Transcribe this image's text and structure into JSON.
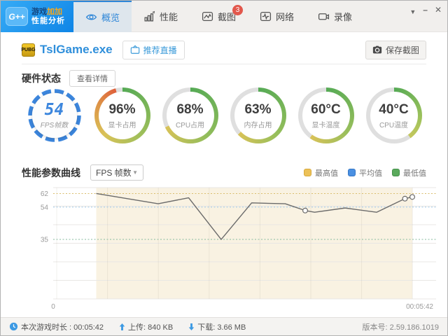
{
  "logo": {
    "badge": "G++",
    "line1_part1": "游戏",
    "line1_part2": "加加",
    "line2": "性能分析"
  },
  "window_controls": {
    "dropdown": "▼",
    "minimize": "–",
    "close": "✕"
  },
  "tabs": [
    {
      "label": "概览",
      "icon": "eye-icon",
      "active": true
    },
    {
      "label": "性能",
      "icon": "bar-chart-icon"
    },
    {
      "label": "截图",
      "icon": "picture-icon",
      "badge": "3"
    },
    {
      "label": "网络",
      "icon": "pulse-icon"
    },
    {
      "label": "录像",
      "icon": "video-camera-icon"
    }
  ],
  "title_bar": {
    "game_icon": "PUBG",
    "process_name": "TslGame.exe",
    "live_button": "推荐直播",
    "save_screenshot_button": "保存截图"
  },
  "hardware": {
    "section_title": "硬件状态",
    "details_button": "查看详情",
    "gauges": [
      {
        "type": "fps",
        "value": "54",
        "label": "FPS帧数",
        "ring_color": "#3c86dd"
      },
      {
        "value": "96%",
        "label": "显卡占用",
        "percent": 96,
        "ring_stops": [
          "#55aa55 0%",
          "#9fbf5a 38%",
          "#d9c258 62%",
          "#dd9447 82%",
          "#df5f3b 96%"
        ]
      },
      {
        "value": "68%",
        "label": "CPU占用",
        "percent": 68,
        "ring_stops": [
          "#55aa55 0%",
          "#93bd5b 40%",
          "#d9c258 68%"
        ]
      },
      {
        "value": "63%",
        "label": "内存占用",
        "percent": 63,
        "ring_stops": [
          "#55aa55 0%",
          "#97bf5b 38%",
          "#d9c258 63%"
        ]
      },
      {
        "value": "60°C",
        "label": "显卡温度",
        "percent": 60,
        "ring_stops": [
          "#55aa55 0%",
          "#9abf5c 36%",
          "#d9c258 60%"
        ]
      },
      {
        "value": "40°C",
        "label": "CPU温度",
        "percent": 40,
        "ring_stops": [
          "#55aa55 0%",
          "#a2c35c 28%",
          "#c6c75c 40%"
        ]
      }
    ],
    "ring_rest_color": "#dfdfdf"
  },
  "performance": {
    "section_title": "性能参数曲线",
    "metric_dropdown": "FPS 帧数",
    "legend": [
      {
        "label": "最高值",
        "color": "#ecc158",
        "border": "#d7a93c"
      },
      {
        "label": "平均值",
        "color": "#4a90e2",
        "border": "#3576c4"
      },
      {
        "label": "最低值",
        "color": "#5aaa5c",
        "border": "#44914a"
      }
    ]
  },
  "chart_data": {
    "type": "line",
    "title": "FPS 帧数",
    "x_axis": {
      "start_label": "0",
      "end_label": "00:05:42",
      "max_seconds": 342
    },
    "ylim": [
      0,
      65.5
    ],
    "y_ticks": [
      62,
      54,
      35
    ],
    "reference_lines": [
      {
        "name": "最高值",
        "value": 62,
        "color": "#d9bd6c"
      },
      {
        "name": "平均值",
        "value": 54,
        "color": "#9cc6e8"
      },
      {
        "name": "最低值",
        "value": 35,
        "color": "#86bb9e"
      }
    ],
    "points": [
      [
        41,
        62
      ],
      [
        100,
        56
      ],
      [
        129,
        59.5
      ],
      [
        160,
        35
      ],
      [
        189,
        56.5
      ],
      [
        221,
        56
      ],
      [
        240,
        52
      ],
      [
        249,
        51
      ],
      [
        278,
        53.5
      ],
      [
        308,
        51
      ],
      [
        335,
        59
      ],
      [
        342,
        60
      ]
    ],
    "marker_indices": [
      6,
      10,
      11
    ],
    "line_color": "#6b6b6b",
    "band_color": "#f9f2e2",
    "grid": true,
    "legend_position": "top-right"
  },
  "status_bar": {
    "session_label": "本次游戏时长 : 00:05:42",
    "upload": "上传: 840 KB",
    "download": "下载: 3.66 MB",
    "version": "版本号: 2.59.186.1019"
  }
}
